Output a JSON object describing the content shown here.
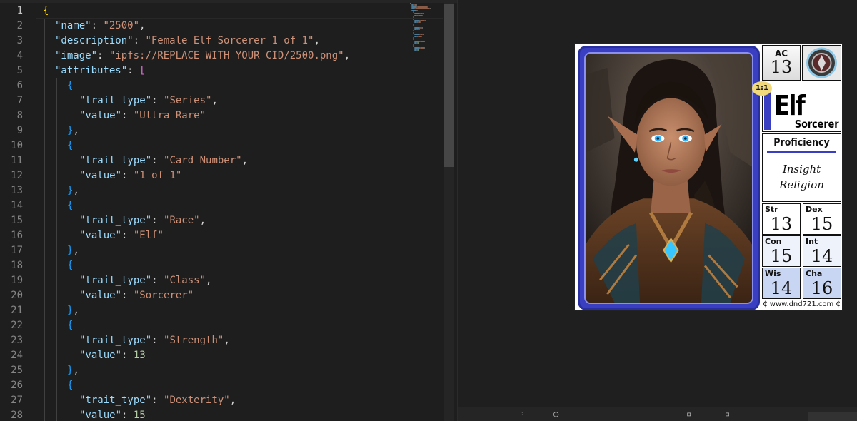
{
  "editor": {
    "lines": [
      {
        "n": "1",
        "indent": 0,
        "tokens": [
          {
            "t": "{",
            "c": "brace"
          }
        ]
      },
      {
        "n": "2",
        "indent": 1,
        "tokens": [
          {
            "t": "\"name\"",
            "c": "key"
          },
          {
            "t": ": ",
            "c": "punc"
          },
          {
            "t": "\"2500\"",
            "c": "str"
          },
          {
            "t": ",",
            "c": "punc"
          }
        ]
      },
      {
        "n": "3",
        "indent": 1,
        "tokens": [
          {
            "t": "\"description\"",
            "c": "key"
          },
          {
            "t": ": ",
            "c": "punc"
          },
          {
            "t": "\"Female Elf Sorcerer 1 of 1\"",
            "c": "str"
          },
          {
            "t": ",",
            "c": "punc"
          }
        ]
      },
      {
        "n": "4",
        "indent": 1,
        "tokens": [
          {
            "t": "\"image\"",
            "c": "key"
          },
          {
            "t": ": ",
            "c": "punc"
          },
          {
            "t": "\"ipfs://REPLACE_WITH_YOUR_CID/2500.png\"",
            "c": "str"
          },
          {
            "t": ",",
            "c": "punc"
          }
        ]
      },
      {
        "n": "5",
        "indent": 1,
        "tokens": [
          {
            "t": "\"attributes\"",
            "c": "key"
          },
          {
            "t": ": ",
            "c": "punc"
          },
          {
            "t": "[",
            "c": "bracket"
          }
        ]
      },
      {
        "n": "6",
        "indent": 2,
        "tokens": [
          {
            "t": "{",
            "c": "curly"
          }
        ]
      },
      {
        "n": "7",
        "indent": 3,
        "tokens": [
          {
            "t": "\"trait_type\"",
            "c": "key"
          },
          {
            "t": ": ",
            "c": "punc"
          },
          {
            "t": "\"Series\"",
            "c": "str"
          },
          {
            "t": ",",
            "c": "punc"
          }
        ]
      },
      {
        "n": "8",
        "indent": 3,
        "tokens": [
          {
            "t": "\"value\"",
            "c": "key"
          },
          {
            "t": ": ",
            "c": "punc"
          },
          {
            "t": "\"Ultra Rare\"",
            "c": "str"
          }
        ]
      },
      {
        "n": "9",
        "indent": 2,
        "tokens": [
          {
            "t": "}",
            "c": "curly"
          },
          {
            "t": ",",
            "c": "punc"
          }
        ]
      },
      {
        "n": "10",
        "indent": 2,
        "tokens": [
          {
            "t": "{",
            "c": "curly"
          }
        ]
      },
      {
        "n": "11",
        "indent": 3,
        "tokens": [
          {
            "t": "\"trait_type\"",
            "c": "key"
          },
          {
            "t": ": ",
            "c": "punc"
          },
          {
            "t": "\"Card Number\"",
            "c": "str"
          },
          {
            "t": ",",
            "c": "punc"
          }
        ]
      },
      {
        "n": "12",
        "indent": 3,
        "tokens": [
          {
            "t": "\"value\"",
            "c": "key"
          },
          {
            "t": ": ",
            "c": "punc"
          },
          {
            "t": "\"1 of 1\"",
            "c": "str"
          }
        ]
      },
      {
        "n": "13",
        "indent": 2,
        "tokens": [
          {
            "t": "}",
            "c": "curly"
          },
          {
            "t": ",",
            "c": "punc"
          }
        ]
      },
      {
        "n": "14",
        "indent": 2,
        "tokens": [
          {
            "t": "{",
            "c": "curly"
          }
        ]
      },
      {
        "n": "15",
        "indent": 3,
        "tokens": [
          {
            "t": "\"trait_type\"",
            "c": "key"
          },
          {
            "t": ": ",
            "c": "punc"
          },
          {
            "t": "\"Race\"",
            "c": "str"
          },
          {
            "t": ",",
            "c": "punc"
          }
        ]
      },
      {
        "n": "16",
        "indent": 3,
        "tokens": [
          {
            "t": "\"value\"",
            "c": "key"
          },
          {
            "t": ": ",
            "c": "punc"
          },
          {
            "t": "\"Elf\"",
            "c": "str"
          }
        ]
      },
      {
        "n": "17",
        "indent": 2,
        "tokens": [
          {
            "t": "}",
            "c": "curly"
          },
          {
            "t": ",",
            "c": "punc"
          }
        ]
      },
      {
        "n": "18",
        "indent": 2,
        "tokens": [
          {
            "t": "{",
            "c": "curly"
          }
        ]
      },
      {
        "n": "19",
        "indent": 3,
        "tokens": [
          {
            "t": "\"trait_type\"",
            "c": "key"
          },
          {
            "t": ": ",
            "c": "punc"
          },
          {
            "t": "\"Class\"",
            "c": "str"
          },
          {
            "t": ",",
            "c": "punc"
          }
        ]
      },
      {
        "n": "20",
        "indent": 3,
        "tokens": [
          {
            "t": "\"value\"",
            "c": "key"
          },
          {
            "t": ": ",
            "c": "punc"
          },
          {
            "t": "\"Sorcerer\"",
            "c": "str"
          }
        ]
      },
      {
        "n": "21",
        "indent": 2,
        "tokens": [
          {
            "t": "}",
            "c": "curly"
          },
          {
            "t": ",",
            "c": "punc"
          }
        ]
      },
      {
        "n": "22",
        "indent": 2,
        "tokens": [
          {
            "t": "{",
            "c": "curly"
          }
        ]
      },
      {
        "n": "23",
        "indent": 3,
        "tokens": [
          {
            "t": "\"trait_type\"",
            "c": "key"
          },
          {
            "t": ": ",
            "c": "punc"
          },
          {
            "t": "\"Strength\"",
            "c": "str"
          },
          {
            "t": ",",
            "c": "punc"
          }
        ]
      },
      {
        "n": "24",
        "indent": 3,
        "tokens": [
          {
            "t": "\"value\"",
            "c": "key"
          },
          {
            "t": ": ",
            "c": "punc"
          },
          {
            "t": "13",
            "c": "num"
          }
        ]
      },
      {
        "n": "25",
        "indent": 2,
        "tokens": [
          {
            "t": "}",
            "c": "curly"
          },
          {
            "t": ",",
            "c": "punc"
          }
        ]
      },
      {
        "n": "26",
        "indent": 2,
        "tokens": [
          {
            "t": "{",
            "c": "curly"
          }
        ]
      },
      {
        "n": "27",
        "indent": 3,
        "tokens": [
          {
            "t": "\"trait_type\"",
            "c": "key"
          },
          {
            "t": ": ",
            "c": "punc"
          },
          {
            "t": "\"Dexterity\"",
            "c": "str"
          },
          {
            "t": ",",
            "c": "punc"
          }
        ]
      },
      {
        "n": "28",
        "indent": 3,
        "tokens": [
          {
            "t": "\"value\"",
            "c": "key"
          },
          {
            "t": ": ",
            "c": "punc"
          },
          {
            "t": "15",
            "c": "num"
          }
        ]
      }
    ],
    "colors": {
      "background": "#1e1e1e",
      "line_number": "#858585",
      "key": "#9cdcfe",
      "string": "#ce9178",
      "number": "#b5cea8",
      "brace": "#ffd700",
      "bracket": "#da70d6",
      "curly": "#179fff"
    }
  },
  "card": {
    "ac_label": "AC",
    "ac_value": "13",
    "rarity": "1:1",
    "race": "Elf",
    "class": "Sorcerer",
    "proficiency_title": "Proficiency",
    "proficiencies": [
      "Insight",
      "Religion"
    ],
    "stats": [
      {
        "label": "Str",
        "value": "13"
      },
      {
        "label": "Dex",
        "value": "15"
      },
      {
        "label": "Con",
        "value": "15"
      },
      {
        "label": "Int",
        "value": "14"
      },
      {
        "label": "Wis",
        "value": "14"
      },
      {
        "label": "Cha",
        "value": "16"
      }
    ],
    "website": "www.dnd721.com",
    "accent_color": "#3a3fc2"
  }
}
